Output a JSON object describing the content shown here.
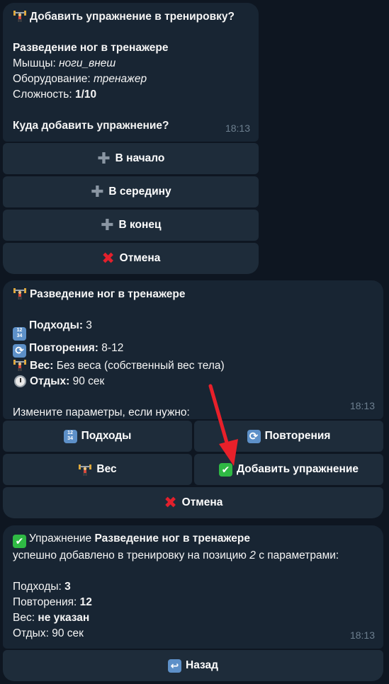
{
  "msg1": {
    "title": "Добавить упражнение в тренировку?",
    "exercise_name": "Разведение ног в тренажере",
    "muscles_label": "Мышцы:",
    "muscles_value": "ноги_внеш",
    "equipment_label": "Оборудование:",
    "equipment_value": "тренажер",
    "difficulty_label": "Сложность:",
    "difficulty_value": "1/10",
    "question": "Куда добавить упражнение?",
    "time": "18:13",
    "buttons": {
      "start": "В начало",
      "middle": "В середину",
      "end": "В конец",
      "cancel": "Отмена"
    }
  },
  "msg2": {
    "exercise_name": "Разведение ног в тренажере",
    "sets_label": "Подходы:",
    "sets_value": "3",
    "reps_label": "Повторения:",
    "reps_value": "8-12",
    "weight_label": "Вес:",
    "weight_value": "Без веса (собственный вес тела)",
    "rest_label": "Отдых:",
    "rest_value": "90 сек",
    "prompt": "Измените параметры, если нужно:",
    "time": "18:13",
    "buttons": {
      "sets": "Подходы",
      "reps": "Повторения",
      "weight": "Вес",
      "add": "Добавить упражнение",
      "cancel": "Отмена"
    }
  },
  "msg3": {
    "prefix": "Упражнение",
    "exercise_name": "Разведение ног в тренажере",
    "line2_a": "успешно добавлено в тренировку на позицию",
    "position": "2",
    "line2_b": "с параметрами:",
    "sets_label": "Подходы:",
    "sets_value": "3",
    "reps_label": "Повторения:",
    "reps_value": "12",
    "weight_label": "Вес:",
    "weight_value": "не указан",
    "rest_label": "Отдых:",
    "rest_value": "90 сек",
    "time": "18:13",
    "buttons": {
      "back": "Назад"
    }
  },
  "colors": {
    "background": "#0e1621",
    "bubble": "#182533",
    "button": "#1e2c3a",
    "time": "#6d7f8f",
    "arrow": "#e8202a",
    "cancel_cross": "#e3202c",
    "check": "#2fb944"
  },
  "icons": {
    "title": "weightlifter-icon",
    "sets": "numbers-icon",
    "reps": "repeat-icon",
    "weight": "weightlifter-icon",
    "rest": "stopwatch-icon",
    "add_pos": "plus-icon",
    "cancel": "cross-icon",
    "confirm": "check-icon",
    "back": "return-icon"
  }
}
